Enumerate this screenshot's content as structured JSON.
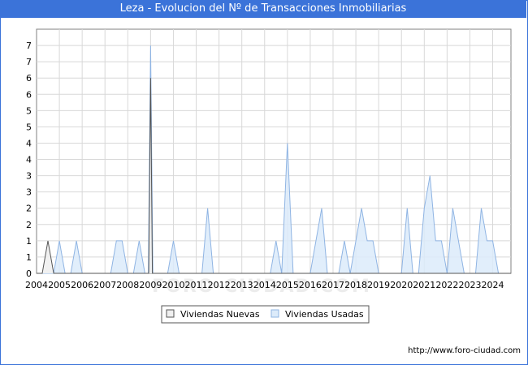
{
  "title": "Leza - Evolucion del Nº de Transacciones Inmobiliarias",
  "footer_url": "http://www.foro-ciudad.com",
  "watermark": "FORO-CIUDAD.COM",
  "colors": {
    "title_bg": "#3b73d9",
    "nuevas_fill": "#f0f0f0",
    "nuevas_line": "#555555",
    "usadas_fill": "#dcebfa",
    "usadas_line": "#8fb4e3",
    "grid": "#d8d8d8"
  },
  "chart_data": {
    "type": "area",
    "y_tick_labels": [
      "0",
      "1",
      "1",
      "2",
      "2",
      "3",
      "3",
      "4",
      "4",
      "5",
      "5",
      "6",
      "6",
      "7",
      "7"
    ],
    "ylim": [
      0,
      7.5
    ],
    "xlim": [
      2004,
      2024.8
    ],
    "x_tick_labels": [
      "2004",
      "2005",
      "2006",
      "2007",
      "2008",
      "2009",
      "2010",
      "2011",
      "2012",
      "2013",
      "2014",
      "2015",
      "2016",
      "2017",
      "2018",
      "2019",
      "2020",
      "2021",
      "2022",
      "2023",
      "2024"
    ],
    "grid": true,
    "legend_position": "bottom-center",
    "series": [
      {
        "name": "Viviendas Nuevas",
        "points": [
          [
            2004.25,
            0
          ],
          [
            2004.5,
            1
          ],
          [
            2004.75,
            0
          ],
          [
            2008.92,
            0
          ],
          [
            2009.0,
            6
          ],
          [
            2009.08,
            0
          ]
        ]
      },
      {
        "name": "Viviendas Usadas",
        "points": [
          [
            2004.75,
            0
          ],
          [
            2005.0,
            1
          ],
          [
            2005.25,
            0
          ],
          [
            2005.5,
            0
          ],
          [
            2005.75,
            1
          ],
          [
            2006.0,
            0
          ],
          [
            2007.25,
            0
          ],
          [
            2007.5,
            1
          ],
          [
            2007.75,
            1
          ],
          [
            2008.0,
            0
          ],
          [
            2008.25,
            0
          ],
          [
            2008.5,
            1
          ],
          [
            2008.75,
            0
          ],
          [
            2008.9,
            0
          ],
          [
            2009.0,
            7
          ],
          [
            2009.1,
            0
          ],
          [
            2009.75,
            0
          ],
          [
            2010.0,
            1
          ],
          [
            2010.25,
            0
          ],
          [
            2011.25,
            0
          ],
          [
            2011.5,
            2
          ],
          [
            2011.75,
            0
          ],
          [
            2014.25,
            0
          ],
          [
            2014.5,
            1
          ],
          [
            2014.75,
            0
          ],
          [
            2015.0,
            4
          ],
          [
            2015.25,
            0
          ],
          [
            2016.0,
            0
          ],
          [
            2016.5,
            2
          ],
          [
            2016.75,
            0
          ],
          [
            2017.25,
            0
          ],
          [
            2017.5,
            1
          ],
          [
            2017.75,
            0
          ],
          [
            2018.0,
            1
          ],
          [
            2018.25,
            2
          ],
          [
            2018.5,
            1
          ],
          [
            2018.75,
            1
          ],
          [
            2019.0,
            0
          ],
          [
            2020.0,
            0
          ],
          [
            2020.25,
            2
          ],
          [
            2020.5,
            0
          ],
          [
            2020.75,
            0
          ],
          [
            2021.0,
            2
          ],
          [
            2021.25,
            3
          ],
          [
            2021.5,
            1
          ],
          [
            2021.75,
            1
          ],
          [
            2022.0,
            0
          ],
          [
            2022.25,
            2
          ],
          [
            2022.75,
            0
          ],
          [
            2023.25,
            0
          ],
          [
            2023.5,
            2
          ],
          [
            2023.75,
            1
          ],
          [
            2024.0,
            1
          ],
          [
            2024.25,
            0
          ]
        ]
      }
    ]
  }
}
